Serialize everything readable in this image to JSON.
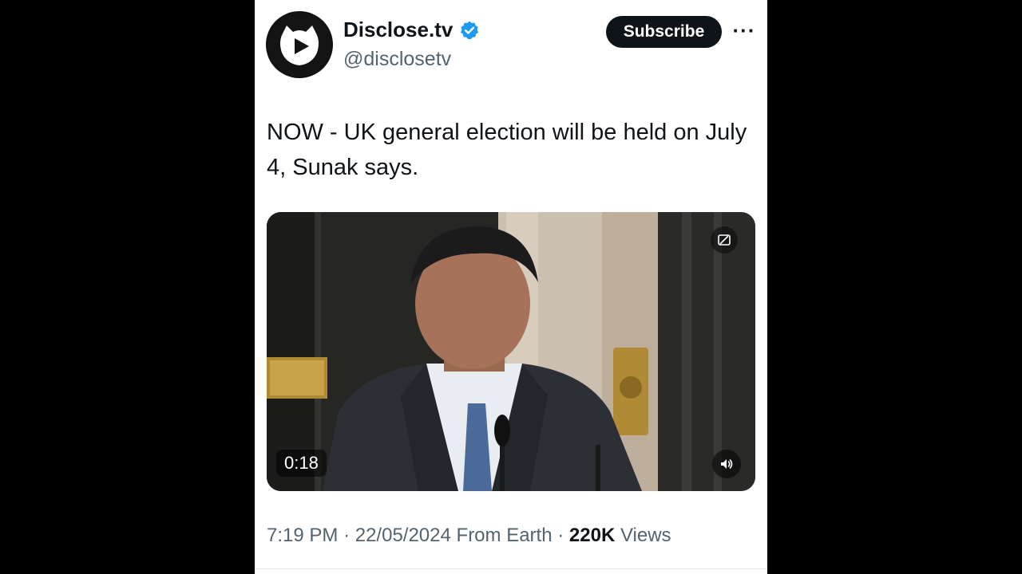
{
  "author": {
    "name": "Disclose.tv",
    "handle": "@disclosetv",
    "avatar_icon": "play-cat-logo-icon",
    "verified_icon": "verified-badge-icon",
    "verified_color": "#1d9bf0"
  },
  "actions": {
    "subscribe_label": "Subscribe",
    "more_label": "···"
  },
  "tweet": {
    "text": "NOW - UK general election will be held on July 4, Sunak says."
  },
  "media": {
    "duration": "0:18",
    "settings_icon": "media-settings-icon",
    "volume_icon": "volume-icon"
  },
  "meta": {
    "time": "7:19 PM",
    "separator": "·",
    "date": "22/05/2024",
    "source": "From Earth",
    "views_count": "220K",
    "views_label": "Views"
  },
  "colors": {
    "text_primary": "#0f1419",
    "text_secondary": "#536471",
    "button_bg": "#0f1419"
  }
}
